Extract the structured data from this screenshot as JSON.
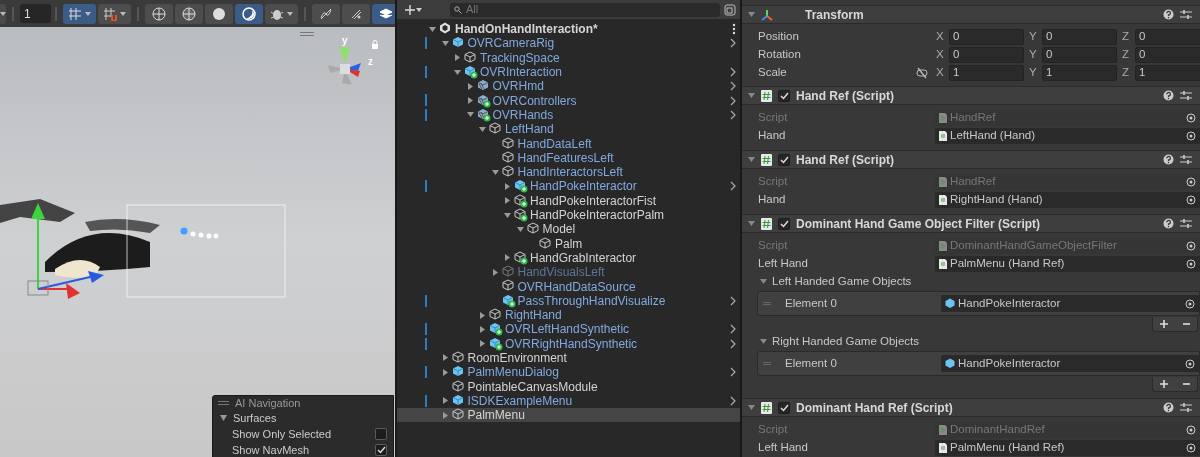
{
  "scene_view": {
    "toolbar": {
      "grid_size": "1",
      "groups": [
        [
          {
            "kind": "grid",
            "on": true,
            "dropdown": true
          },
          {
            "kind": "snap",
            "on": false,
            "dropdown": true
          }
        ],
        [
          {
            "kind": "wireframe",
            "on": false,
            "dropdown": false
          },
          {
            "kind": "shaded-wireframe",
            "on": false,
            "dropdown": false
          },
          {
            "kind": "shaded",
            "on": false,
            "dropdown": false
          },
          {
            "kind": "lit",
            "on": true,
            "dropdown": false
          },
          {
            "kind": "bug",
            "on": false,
            "dropdown": true
          }
        ],
        [
          {
            "kind": "fx-off",
            "on": false,
            "dropdown": false
          },
          {
            "kind": "audio-off",
            "on": false,
            "dropdown": false
          },
          {
            "kind": "layers",
            "on": true,
            "dropdown": false
          }
        ]
      ]
    },
    "gizmo": {
      "labels": [
        "y",
        "z"
      ]
    },
    "ai_navigation": {
      "title": "AI Navigation",
      "section": {
        "label": "Surfaces",
        "expanded": true
      },
      "options": [
        {
          "label": "Show Only Selected",
          "checked": false
        },
        {
          "label": "Show NavMesh",
          "checked": true
        }
      ]
    }
  },
  "hierarchy": {
    "search": {
      "placeholder": "All"
    },
    "items": [
      {
        "name": "HandOnHandInteraction*",
        "kind": "scene",
        "expanded": true,
        "prefab": false,
        "disabled": false,
        "overridden": false,
        "chevron": false,
        "selected": false,
        "children": [
          {
            "name": "OVRCameraRig",
            "kind": "prefab",
            "expanded": true,
            "prefab": true,
            "disabled": false,
            "overridden": true,
            "chevron": true,
            "selected": false,
            "children": [
              {
                "name": "TrackingSpace",
                "kind": "object",
                "expanded": false,
                "prefab": true,
                "disabled": false,
                "overridden": false,
                "chevron": false,
                "selected": false
              },
              {
                "name": "OVRInteraction",
                "kind": "prefab-added",
                "expanded": true,
                "prefab": true,
                "disabled": false,
                "overridden": true,
                "chevron": true,
                "selected": false,
                "children": [
                  {
                    "name": "OVRHmd",
                    "kind": "variant",
                    "expanded": false,
                    "prefab": true,
                    "disabled": false,
                    "overridden": false,
                    "chevron": true,
                    "selected": false
                  },
                  {
                    "name": "OVRControllers",
                    "kind": "variant-added",
                    "expanded": false,
                    "prefab": true,
                    "disabled": false,
                    "overridden": true,
                    "chevron": true,
                    "selected": false
                  },
                  {
                    "name": "OVRHands",
                    "kind": "variant-added",
                    "expanded": true,
                    "prefab": true,
                    "disabled": false,
                    "overridden": true,
                    "chevron": true,
                    "selected": false,
                    "children": [
                      {
                        "name": "LeftHand",
                        "kind": "object",
                        "expanded": true,
                        "prefab": true,
                        "disabled": false,
                        "overridden": false,
                        "chevron": false,
                        "selected": false,
                        "children": [
                          {
                            "name": "HandDataLeft",
                            "kind": "object",
                            "prefab": true,
                            "disabled": false,
                            "overridden": false,
                            "chevron": false,
                            "selected": false
                          },
                          {
                            "name": "HandFeaturesLeft",
                            "kind": "object",
                            "prefab": true,
                            "disabled": false,
                            "overridden": false,
                            "chevron": false,
                            "selected": false
                          },
                          {
                            "name": "HandInteractorsLeft",
                            "kind": "object",
                            "expanded": true,
                            "prefab": true,
                            "disabled": false,
                            "overridden": false,
                            "chevron": false,
                            "selected": false,
                            "children": [
                              {
                                "name": "HandPokeInteractor",
                                "kind": "prefab-added",
                                "expanded": false,
                                "prefab": true,
                                "disabled": false,
                                "overridden": true,
                                "chevron": true,
                                "selected": false
                              },
                              {
                                "name": "HandPokeInteractorFist",
                                "kind": "object-added",
                                "expanded": false,
                                "prefab": false,
                                "disabled": false,
                                "overridden": false,
                                "chevron": false,
                                "selected": false
                              },
                              {
                                "name": "HandPokeInteractorPalm",
                                "kind": "object-added",
                                "expanded": true,
                                "prefab": false,
                                "disabled": false,
                                "overridden": false,
                                "chevron": false,
                                "selected": false,
                                "children": [
                                  {
                                    "name": "Model",
                                    "kind": "object",
                                    "expanded": true,
                                    "prefab": false,
                                    "disabled": false,
                                    "overridden": false,
                                    "chevron": false,
                                    "selected": false,
                                    "children": [
                                      {
                                        "name": "Palm",
                                        "kind": "object",
                                        "prefab": false,
                                        "disabled": false,
                                        "overridden": false,
                                        "chevron": false,
                                        "selected": false
                                      }
                                    ]
                                  }
                                ]
                              },
                              {
                                "name": "HandGrabInteractor",
                                "kind": "object-added",
                                "expanded": false,
                                "prefab": false,
                                "disabled": false,
                                "overridden": false,
                                "chevron": false,
                                "selected": false
                              }
                            ]
                          },
                          {
                            "name": "HandVisualsLeft",
                            "kind": "object",
                            "expanded": false,
                            "prefab": true,
                            "disabled": true,
                            "overridden": false,
                            "chevron": false,
                            "selected": false
                          },
                          {
                            "name": "OVRHandDataSource",
                            "kind": "object",
                            "prefab": true,
                            "disabled": false,
                            "overridden": false,
                            "chevron": false,
                            "selected": false
                          },
                          {
                            "name": "PassThroughHandVisualize",
                            "kind": "prefab-added",
                            "prefab": true,
                            "disabled": false,
                            "overridden": true,
                            "chevron": true,
                            "selected": false
                          }
                        ]
                      },
                      {
                        "name": "RightHand",
                        "kind": "object",
                        "expanded": false,
                        "prefab": true,
                        "disabled": false,
                        "overridden": false,
                        "chevron": false,
                        "selected": false
                      },
                      {
                        "name": "OVRLeftHandSynthetic",
                        "kind": "prefab-added",
                        "expanded": false,
                        "prefab": true,
                        "disabled": false,
                        "overridden": true,
                        "chevron": true,
                        "selected": false
                      },
                      {
                        "name": "OVRRightHandSynthetic",
                        "kind": "prefab-added",
                        "expanded": false,
                        "prefab": true,
                        "disabled": false,
                        "overridden": true,
                        "chevron": true,
                        "selected": false
                      }
                    ]
                  }
                ]
              }
            ]
          },
          {
            "name": "RoomEnvironment",
            "kind": "object",
            "expanded": false,
            "prefab": false,
            "disabled": false,
            "overridden": false,
            "chevron": false,
            "selected": false
          },
          {
            "name": "PalmMenuDialog",
            "kind": "prefab",
            "expanded": false,
            "prefab": true,
            "disabled": false,
            "overridden": true,
            "chevron": true,
            "selected": false
          },
          {
            "name": "PointableCanvasModule",
            "kind": "object",
            "prefab": false,
            "disabled": false,
            "overridden": false,
            "chevron": false,
            "selected": false
          },
          {
            "name": "ISDKExampleMenu",
            "kind": "prefab",
            "expanded": false,
            "prefab": true,
            "disabled": false,
            "overridden": true,
            "chevron": true,
            "selected": false
          },
          {
            "name": "PalmMenu",
            "kind": "object",
            "expanded": false,
            "prefab": false,
            "disabled": false,
            "overridden": false,
            "chevron": false,
            "selected": true
          }
        ]
      }
    ]
  },
  "inspector": {
    "transform": {
      "title": "Transform",
      "expanded": true,
      "scale_constrained": false,
      "rows": [
        {
          "label": "Position",
          "values": [
            {
              "axis": "X",
              "value": "0"
            },
            {
              "axis": "Y",
              "value": "0"
            },
            {
              "axis": "Z",
              "value": "0"
            }
          ]
        },
        {
          "label": "Rotation",
          "values": [
            {
              "axis": "X",
              "value": "0"
            },
            {
              "axis": "Y",
              "value": "0"
            },
            {
              "axis": "Z",
              "value": "0"
            }
          ]
        },
        {
          "label": "Scale",
          "values": [
            {
              "axis": "X",
              "value": "1"
            },
            {
              "axis": "Y",
              "value": "1"
            },
            {
              "axis": "Z",
              "value": "1"
            }
          ]
        }
      ]
    },
    "components": [
      {
        "title": "Hand Ref (Script)",
        "enabled": true,
        "expanded": true,
        "fields": [
          {
            "label": "Script",
            "value": "HandRef",
            "kind": "script"
          },
          {
            "label": "Hand",
            "value": "LeftHand (Hand)",
            "kind": "object"
          }
        ]
      },
      {
        "title": "Hand Ref (Script)",
        "enabled": true,
        "expanded": true,
        "fields": [
          {
            "label": "Script",
            "value": "HandRef",
            "kind": "script"
          },
          {
            "label": "Hand",
            "value": "RightHand (Hand)",
            "kind": "object"
          }
        ]
      },
      {
        "title": "Dominant Hand Game Object Filter (Script)",
        "enabled": true,
        "expanded": true,
        "fields": [
          {
            "label": "Script",
            "value": "DominantHandGameObjectFilter",
            "kind": "script"
          },
          {
            "label": "Left Hand",
            "value": "PalmMenu (Hand Ref)",
            "kind": "object"
          }
        ],
        "lists": [
          {
            "label": "Left Handed Game Objects",
            "expanded": true,
            "elements": [
              {
                "label": "Element 0",
                "value": "HandPokeInteractor"
              }
            ]
          },
          {
            "label": "Right Handed Game Objects",
            "expanded": true,
            "elements": [
              {
                "label": "Element 0",
                "value": "HandPokeInteractor"
              }
            ]
          }
        ]
      },
      {
        "title": "Dominant Hand Ref (Script)",
        "enabled": true,
        "expanded": true,
        "fields": [
          {
            "label": "Script",
            "value": "DominantHandRef",
            "kind": "script"
          },
          {
            "label": "Left Hand",
            "value": "PalmMenu (Hand Ref)",
            "kind": "object"
          }
        ]
      }
    ]
  }
}
